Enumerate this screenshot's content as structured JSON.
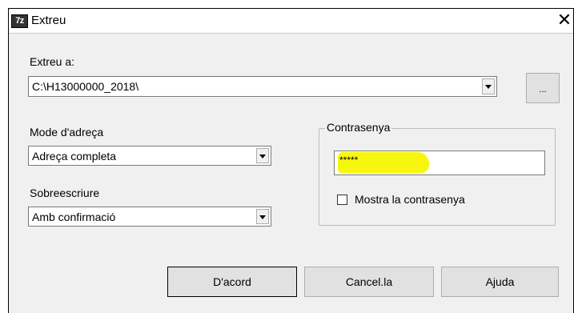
{
  "window": {
    "title": "Extreu",
    "icon_text": "7z",
    "close_glyph": "✕"
  },
  "extract_to": {
    "label": "Extreu a:",
    "path": "C:\\H13000000_2018\\",
    "browse_label": "..."
  },
  "path_mode": {
    "label": "Mode d'adreça",
    "selected": "Adreça completa"
  },
  "overwrite": {
    "label": "Sobreescriure",
    "selected": "Amb confirmació"
  },
  "password": {
    "group_label": "Contrasenya",
    "value": "*****",
    "show_label": "Mostra la contrasenya",
    "highlight_color": "#f6f700"
  },
  "buttons": {
    "ok": "D'acord",
    "cancel": "Cancel.la",
    "help": "Ajuda"
  }
}
